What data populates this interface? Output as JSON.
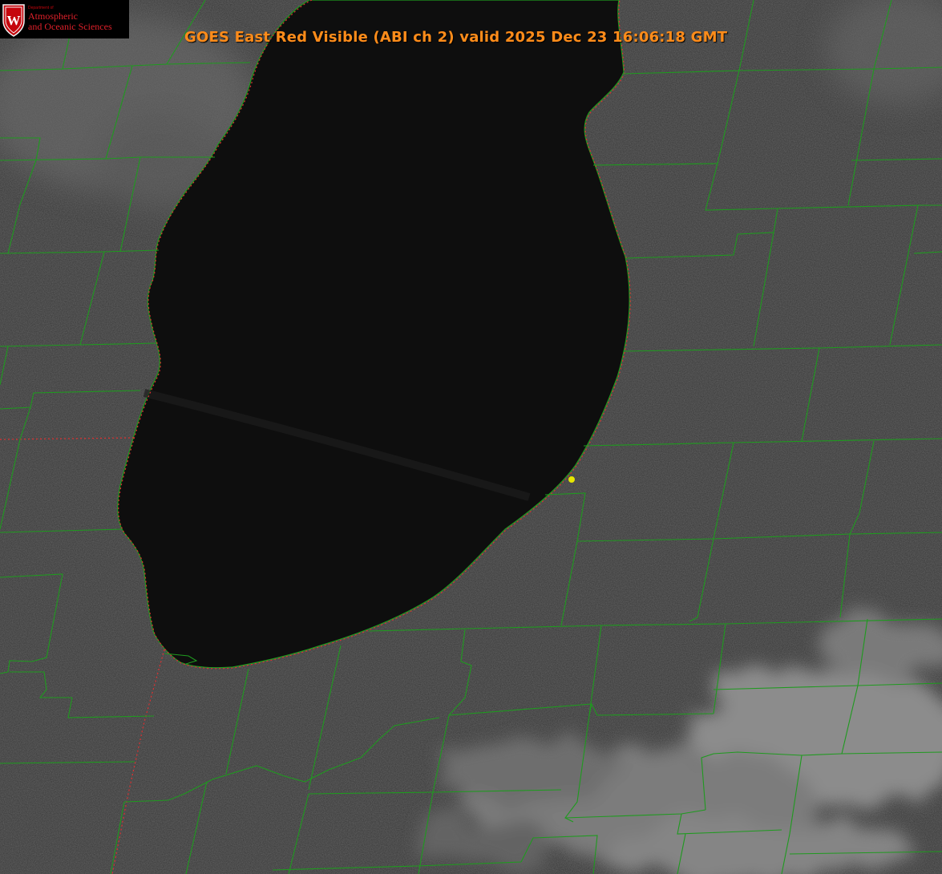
{
  "header": {
    "title": "GOES East Red Visible (ABI ch 2) valid 2025 Dec 23 16:06:18 GMT"
  },
  "logo": {
    "dept_line": "Department of",
    "name_line1": "Atmospheric",
    "name_line2": "and Oceanic Sciences",
    "crest_letter": "W"
  },
  "map": {
    "view": "satellite visible imagery, Lake Michigan with county boundaries",
    "colors": {
      "land": "#3a3a3a",
      "cloud": "#8a8a8a",
      "lake": "#0d0d0d",
      "county_border": "#1f9a1f",
      "state_border": "#e03030",
      "marker": "#e6e600",
      "title": "#ff8c1a",
      "logo_red": "#c5050c"
    },
    "marker_icon": "yellow-dot-icon"
  }
}
